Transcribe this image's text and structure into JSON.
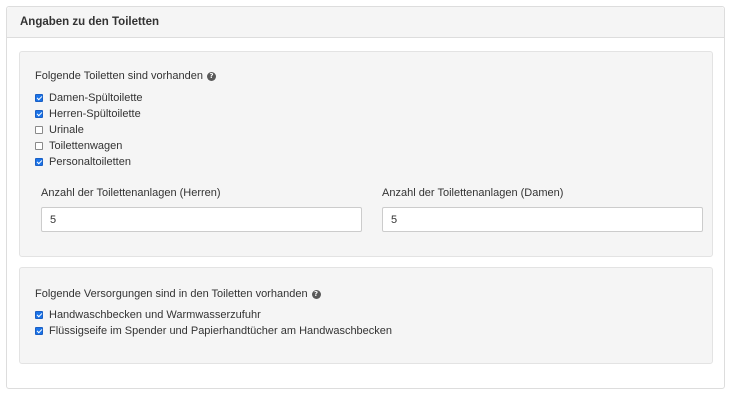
{
  "panel": {
    "title": "Angaben zu den Toiletten"
  },
  "toilets_section": {
    "label": "Folgende Toiletten sind vorhanden",
    "help_icon": "question-circle-icon",
    "options": [
      {
        "label": "Damen-Spültoilette",
        "checked": true
      },
      {
        "label": "Herren-Spültoilette",
        "checked": true
      },
      {
        "label": "Urinale",
        "checked": false
      },
      {
        "label": "Toilettenwagen",
        "checked": false
      },
      {
        "label": "Personaltoiletten",
        "checked": true
      }
    ],
    "count_men": {
      "label": "Anzahl der Toilettenanlagen (Herren)",
      "value": "5"
    },
    "count_women": {
      "label": "Anzahl der Toilettenanlagen (Damen)",
      "value": "5"
    }
  },
  "supplies_section": {
    "label": "Folgende Versorgungen sind in den Toiletten vorhanden",
    "help_icon": "question-circle-icon",
    "options": [
      {
        "label": "Handwaschbecken und Warmwasserzufuhr",
        "checked": true
      },
      {
        "label": "Flüssigseife im Spender und Papierhandtücher am Handwaschbecken",
        "checked": true
      }
    ]
  },
  "colors": {
    "checkbox_checked": "#1a73e8",
    "panel_heading_bg": "#f5f5f5",
    "well_bg": "#f5f5f5"
  }
}
